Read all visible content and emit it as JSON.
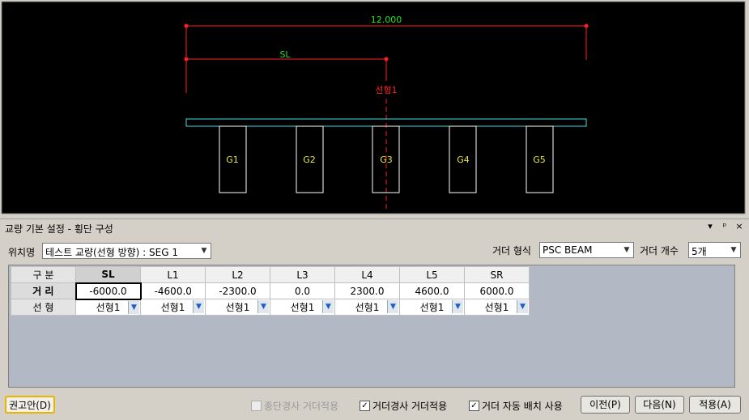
{
  "drawing": {
    "dim_total": "12.000",
    "dim_sl": "SL",
    "alignment_label": "선형1",
    "girders": [
      "G1",
      "G2",
      "G3",
      "G4",
      "G5"
    ]
  },
  "panel": {
    "title": "교량 기본 설정 - 횡단 구성",
    "pin": "▾",
    "dock": "ᵖ",
    "close": "×"
  },
  "form": {
    "position_label": "위치명",
    "position_value": "테스트 교량(선형 방향) : SEG 1",
    "girder_type_label": "거더 형식",
    "girder_type_value": "PSC BEAM",
    "girder_count_label": "거더 개수",
    "girder_count_value": "5개"
  },
  "grid": {
    "corner": "구 분",
    "columns": [
      "SL",
      "L1",
      "L2",
      "L3",
      "L4",
      "L5",
      "SR"
    ],
    "distance_label": "거 리",
    "distances": [
      "-6000.0",
      "-4600.0",
      "-2300.0",
      "0.0",
      "2300.0",
      "4600.0",
      "6000.0"
    ],
    "alignment_row_label": "선 형",
    "alignments": [
      "선형1",
      "선형1",
      "선형1",
      "선형1",
      "선형1",
      "선형1",
      "선형1"
    ]
  },
  "footer": {
    "advice_button": "권고안(D)",
    "chk_longitudinal": "종단경사 거더적용",
    "chk_girder_slope": "거더경사 거더적용",
    "chk_auto_place": "거더 자동 배치 사용",
    "prev_button": "이전(P)",
    "next_button": "다음(N)",
    "apply_button": "적용(A)"
  },
  "colors": {
    "dim_red": "#ff2020",
    "text_green": "#20e020",
    "girder_text": "#e8e840",
    "deck_cyan": "#40e0e0"
  }
}
